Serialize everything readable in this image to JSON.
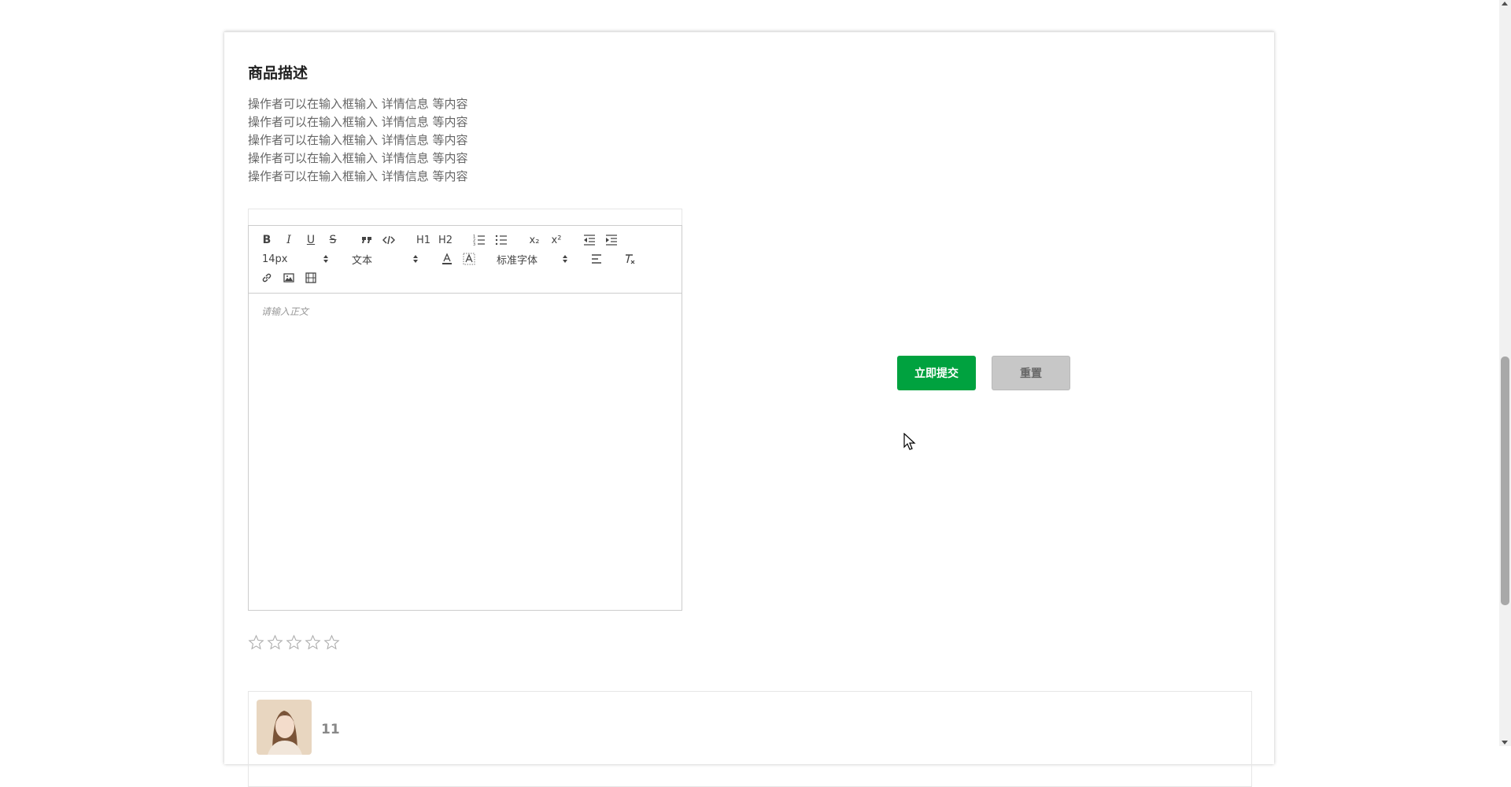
{
  "section": {
    "title": "商品描述",
    "description_lines": [
      "操作者可以在输入框输入 详情信息 等内容",
      "操作者可以在输入框输入 详情信息 等内容",
      "操作者可以在输入框输入 详情信息 等内容",
      "操作者可以在输入框输入 详情信息 等内容",
      "操作者可以在输入框输入 详情信息 等内容"
    ]
  },
  "editor": {
    "toolbar": {
      "bold": "B",
      "italic": "I",
      "underline": "U",
      "strike": "S",
      "h1": "H1",
      "h2": "H2",
      "subscript": "x₂",
      "superscript": "x²",
      "size_value": "14px",
      "header_value": "文本",
      "font_value": "标准字体"
    },
    "placeholder": "请输入正文"
  },
  "actions": {
    "submit_label": "立即提交",
    "reset_label": "重置"
  },
  "rating": {
    "stars_total": 5,
    "stars_filled": 0
  },
  "comment": {
    "user_name": "11"
  },
  "colors": {
    "submit_bg": "#00a23f",
    "reset_bg": "#c7c7c7"
  }
}
